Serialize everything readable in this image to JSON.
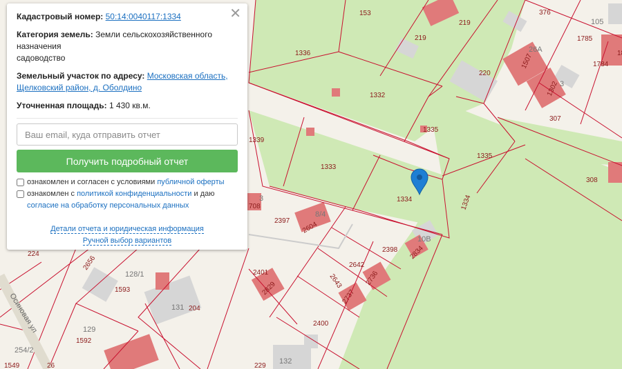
{
  "info_panel": {
    "cadastral_label": "Кадастровый номер:",
    "cadastral_number": "50:14:0040117:1334",
    "category_label": "Категория земель:",
    "category_value_line1": "Земли сельскохозяйственного",
    "category_value_line2": "назначения",
    "category_value_line3": "садоводство",
    "address_label": "Земельный участок по адресу:",
    "address_line1": "Московская область,",
    "address_line2": "Щелковский район, д. Оболдино",
    "area_label": "Уточненная площадь:",
    "area_value": "1 430 кв.м.",
    "email_placeholder": "Ваш email, куда отправить отчет",
    "submit_label": "Получить подробный отчет",
    "consent1_text": "ознакомлен и согласен с условиями",
    "consent1_link": "публичной оферты",
    "consent2_text_a": "ознакомлен с",
    "consent2_link_a": "политикой конфиденциальности",
    "consent2_text_b": "и даю",
    "consent2_link_b": "согласие на обработку персональных данных",
    "details_link": "Детали отчета и юридическая информация",
    "manual_link": "Ручной выбор вариантов",
    "close_glyph": "✕"
  },
  "map": {
    "colors": {
      "green": "#cfe9b5",
      "parcel_line": "#c8102e",
      "building": "#e07a7a",
      "building_gray": "#d6d6d6",
      "background": "#f4f1ea"
    },
    "marker_icon": "map-pin-icon",
    "parcel_labels": [
      "153",
      "219",
      "219",
      "376",
      "105",
      "1785",
      "1784",
      "18",
      "1336",
      "26А",
      "1507",
      "220",
      "1302",
      "3",
      "1332",
      "307",
      "1335",
      "1335",
      "1339",
      "1333",
      "1334",
      "1334",
      "308",
      "3",
      "708",
      "2397",
      "8/4",
      "2604",
      "10В",
      "2834",
      "224",
      "2398",
      "2642",
      "2656",
      "128/1",
      "2736",
      "2401",
      "1593",
      "2829",
      "2643",
      "2737",
      "131",
      "204",
      "129",
      "1592",
      "2400",
      "254/2",
      "1549",
      "229",
      "132",
      "26"
    ],
    "street_label": "Осиновая ул"
  }
}
